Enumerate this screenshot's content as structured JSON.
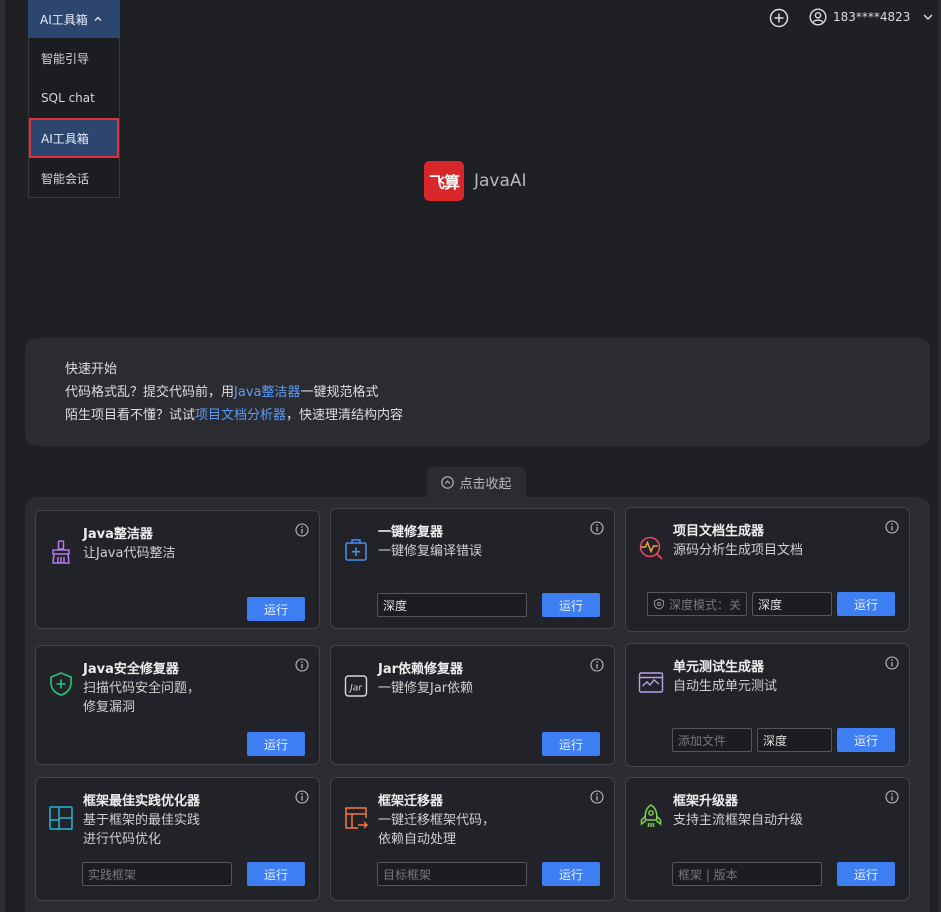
{
  "dropdown": {
    "label": "AI工具箱",
    "items": [
      "智能引导",
      "SQL chat",
      "AI工具箱",
      "智能会话"
    ],
    "active_index": 2
  },
  "header": {
    "user": "183****4823"
  },
  "logo": {
    "mark": "飞算",
    "name": "JavaAI"
  },
  "quick": {
    "title": "快速开始",
    "line1_pre": "代码格式乱？提交代码前，用",
    "line1_link": "Java整洁器",
    "line1_post": "一键规范格式",
    "line2_pre": "陌生项目看不懂？试试",
    "line2_link": "项目文档分析器",
    "line2_post": "，快速理清结构内容"
  },
  "collapse_label": "点击收起",
  "run_label": "运行",
  "cards": {
    "java_cleaner": {
      "title": "Java整洁器",
      "desc": "让Java代码整洁"
    },
    "fixer": {
      "title": "一键修复器",
      "desc": "一键修复编译错误",
      "mode": "深度"
    },
    "docgen": {
      "title": "项目文档生成器",
      "desc": "源码分析生成项目文档",
      "toggle": "深度模式：关",
      "mode": "深度"
    },
    "security": {
      "title": "Java安全修复器",
      "desc1": "扫描代码安全问题，",
      "desc2": "修复漏洞"
    },
    "jar": {
      "title": "Jar依赖修复器",
      "desc": "一键修复Jar依赖"
    },
    "unittest": {
      "title": "单元测试生成器",
      "desc": "自动生成单元测试",
      "file_placeholder": "添加文件",
      "mode": "深度"
    },
    "best": {
      "title": "框架最佳实践优化器",
      "desc1": "基于框架的最佳实践",
      "desc2": "进行代码优化",
      "placeholder": "实践框架"
    },
    "migrate": {
      "title": "框架迁移器",
      "desc1": "一键迁移框架代码，",
      "desc2": "依赖自动处理",
      "placeholder": "目标框架"
    },
    "upgrade": {
      "title": "框架升级器",
      "desc": "支持主流框架自动升级",
      "placeholder": "框架 | 版本"
    }
  }
}
